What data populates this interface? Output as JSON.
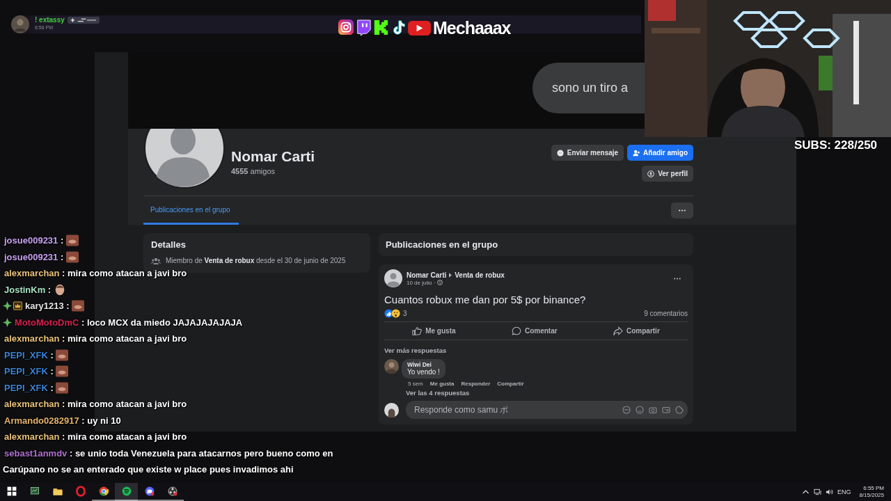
{
  "notification": {
    "user": "! extassy",
    "time": "6:56 PM"
  },
  "stream_logo": {
    "title": "Mechaaax",
    "icons": [
      {
        "kind": "camera"
      },
      {
        "kind": "bubble"
      },
      {
        "kind": "block"
      },
      {
        "kind": "note"
      },
      {
        "kind": "play"
      }
    ]
  },
  "subs_counter": "SUBS: 228/250",
  "facebook": {
    "cover_bubble": "sono un tiro a",
    "profile": {
      "name": "Nomar Carti",
      "friends_count": "4555",
      "friends_label": "amigos"
    },
    "actions": [
      {
        "label": "Enviar mensaje",
        "kind": "message"
      },
      {
        "label": "Añadir amigo",
        "kind": "add"
      },
      {
        "label": "Ver perfil",
        "kind": "profile"
      }
    ],
    "tabs": [
      {
        "label": "Publicaciones en el grupo",
        "selected": true
      }
    ],
    "details": {
      "title": "Detalles",
      "text": "Miembro de **Venta de robux** desde el 30 de junio de 2025"
    },
    "posts_header": "Publicaciones en el grupo",
    "post": {
      "author": "Nomar Carti",
      "group": "Venta de robux",
      "date": "10 de julio ·",
      "text": "Cuantos robux me dan por 5$ por binance?",
      "reaction_count": "3",
      "comment_count": "9 comentarios",
      "actions": [
        {
          "label": "Me gusta",
          "kind": "like"
        },
        {
          "label": "Comentar",
          "kind": "comment"
        },
        {
          "label": "Compartir",
          "kind": "share"
        }
      ],
      "more_replies": "Ver más respuestas",
      "comment": {
        "author": "Wiwi Dei",
        "text": "Yo vendo !",
        "time": "5 sem",
        "actions": [
          "Me gusta",
          "Responder",
          "Compartir"
        ],
        "replies_link": "Ver las 4 respuestas"
      },
      "reply_field": {
        "placeholder": "Responde como samu ポ"
      }
    }
  },
  "chat": [
    {
      "user": "josue009231",
      "color": "#c7a0f0",
      "separator": ":",
      "emotes": [
        {
          "kind": "square"
        }
      ]
    },
    {
      "user": "josue009231",
      "color": "#c7a0f0",
      "separator": ":",
      "emotes": [
        {
          "kind": "square"
        }
      ]
    },
    {
      "user": "alexmarchan",
      "color": "#e9c27a",
      "separator": ":",
      "text": "mira como atacan a javi bro"
    },
    {
      "user": "JostinKm",
      "color": "#a8e0c0",
      "separator": ":",
      "emotes": [
        {
          "kind": "round"
        }
      ]
    },
    {
      "user": "kary1213",
      "color": "#e6e6e6",
      "badges": [
        {
          "kind": "plus"
        },
        {
          "kind": "crown"
        }
      ],
      "separator": ":",
      "emotes": [
        {
          "kind": "square"
        }
      ]
    },
    {
      "user": "MotoMotoDmC",
      "color": "#d6204f",
      "badges": [
        {
          "kind": "plus"
        }
      ],
      "separator": ":",
      "text": "loco MCX da miedo JAJAJAJAJAJA"
    },
    {
      "user": "alexmarchan",
      "color": "#e9c27a",
      "separator": ":",
      "text": "mira como atacan a javi bro"
    },
    {
      "user": "PEPI_XFK",
      "color": "#3a83d6",
      "separator": ":",
      "emotes": [
        {
          "kind": "square"
        }
      ]
    },
    {
      "user": "PEPI_XFK",
      "color": "#3a83d6",
      "separator": ":",
      "emotes": [
        {
          "kind": "square"
        }
      ]
    },
    {
      "user": "PEPI_XFK",
      "color": "#3a83d6",
      "separator": ":",
      "emotes": [
        {
          "kind": "square"
        }
      ]
    },
    {
      "user": "alexmarchan",
      "color": "#e9c27a",
      "separator": ":",
      "text": "mira como atacan a javi bro"
    },
    {
      "user": "Armando0282917",
      "color": "#e6b46e",
      "separator": ":",
      "text": "uy ni 10"
    },
    {
      "user": "alexmarchan",
      "color": "#e9c27a",
      "separator": ":",
      "text": "mira como atacan a javi bro"
    },
    {
      "user": "sebast1anmdv",
      "color": "#b070d0",
      "separator": ":",
      "text": "se unio toda Venezuela para atacarnos pero bueno como en Carúpano no se an enterado que existe w place pues invadimos ahi"
    }
  ],
  "taskbar": {
    "apps": [
      {
        "kind": "start",
        "running": false,
        "selected": false
      },
      {
        "kind": "monitor",
        "running": false,
        "selected": false
      },
      {
        "kind": "folder",
        "running": false,
        "selected": false
      },
      {
        "kind": "ring",
        "running": false,
        "selected": false
      },
      {
        "kind": "browser",
        "running": true,
        "selected": false
      },
      {
        "kind": "music",
        "running": true,
        "selected": true
      },
      {
        "kind": "chat",
        "running": true,
        "selected": false
      },
      {
        "kind": "recorder",
        "running": true,
        "selected": false
      }
    ],
    "language": "ENG",
    "time": "6:55 PM",
    "date": "8/15/2025"
  }
}
